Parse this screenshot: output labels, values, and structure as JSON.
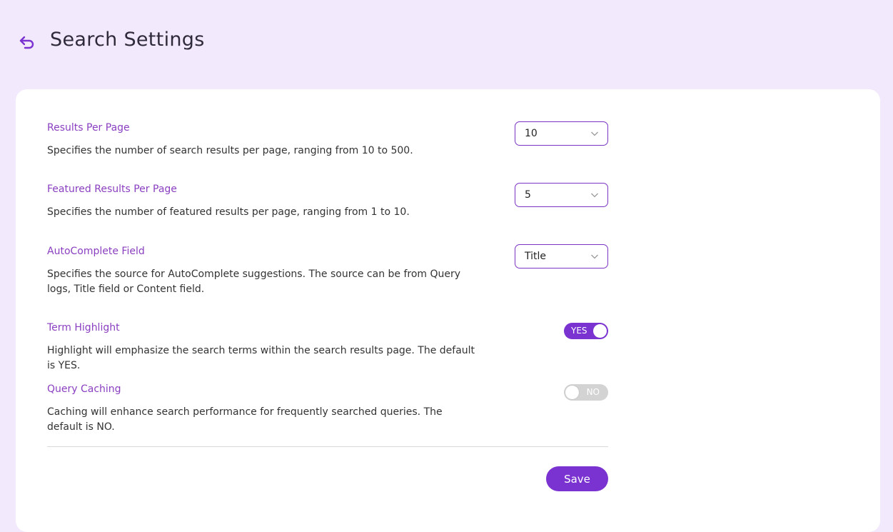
{
  "header": {
    "title": "Search Settings",
    "back_icon": "back-arrow-icon"
  },
  "settings": {
    "results_per_page": {
      "label": "Results Per Page",
      "description": "Specifies the number of search results per page, ranging from 10 to 500.",
      "value": "10"
    },
    "featured_results": {
      "label": "Featured Results Per Page",
      "description": "Specifies the number of featured results per page, ranging from 1 to 10.",
      "value": "5"
    },
    "autocomplete": {
      "label": "AutoComplete Field",
      "description": "Specifies the source for AutoComplete suggestions. The source can be from Query logs, Title field or Content field.",
      "value": "Title"
    },
    "term_highlight": {
      "label": "Term Highlight",
      "description": "Highlight will emphasize the search terms within the search results page. The default is YES.",
      "state": "YES"
    },
    "query_caching": {
      "label": "Query Caching",
      "description": "Caching will enhance search performance for frequently searched queries. The default is NO.",
      "state": "NO"
    }
  },
  "actions": {
    "save_label": "Save"
  },
  "colors": {
    "accent": "#7a32d0",
    "label": "#8a3fc0",
    "background": "#f3e9fd"
  }
}
